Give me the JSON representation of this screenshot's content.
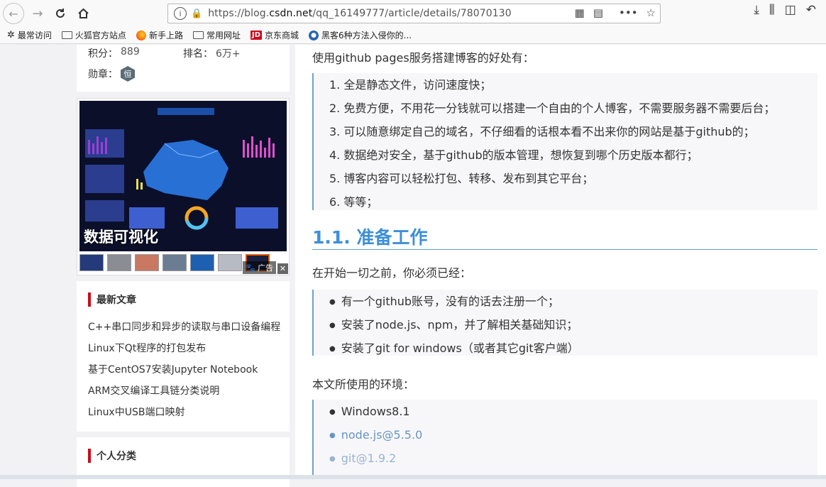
{
  "browser": {
    "url_prefix": "https://blog.",
    "url_domain": "csdn.net",
    "url_path": "/qq_16149777/article/details/78070130",
    "bookmarks": [
      {
        "label": "最常访问",
        "icon": "gear-icon"
      },
      {
        "label": "火狐官方站点",
        "icon": "folder-icon"
      },
      {
        "label": "新手上路",
        "icon": "firefox-icon"
      },
      {
        "label": "常用网址",
        "icon": "folder-icon"
      },
      {
        "label": "京东商城",
        "icon": "jd-icon",
        "icon_text": "JD"
      },
      {
        "label": "黑客6种方法入侵你的...",
        "icon": "globe-icon"
      }
    ]
  },
  "profile": {
    "score_label": "积分：",
    "score_value": "889",
    "rank_label": "排名：",
    "rank_value": "6万+",
    "medal_label": "勋章：",
    "medal_text": "恒"
  },
  "ad": {
    "caption": "数据可视化",
    "tag": "广告",
    "close": "✕"
  },
  "recent": {
    "title": "最新文章",
    "items": [
      "C++串口同步和异步的读取与串口设备编程",
      "Linux下Qt程序的打包发布",
      "基于CentOS7安装Jupyter Notebook",
      "ARM交叉编译工具链分类说明",
      "Linux中USB端口映射"
    ]
  },
  "category": {
    "title": "个人分类"
  },
  "article": {
    "intro": "使用github pages服务搭建博客的好处有：",
    "benefits": [
      "1. 全是静态文件，访问速度快；",
      "2. 免费方便，不用花一分钱就可以搭建一个自由的个人博客，不需要服务器不需要后台；",
      "3. 可以随意绑定自己的域名，不仔细看的话根本看不出来你的网站是基于github的；",
      "4. 数据绝对安全，基于github的版本管理，想恢复到哪个历史版本都行；",
      "5. 博客内容可以轻松打包、转移、发布到其它平台；",
      "6. 等等；"
    ],
    "heading": "1.1. 准备工作",
    "prereq_intro": "在开始一切之前，你必须已经：",
    "prereqs": [
      "有一个github账号，没有的话去注册一个；",
      "安装了node.js、npm，并了解相关基础知识；",
      "安装了git for windows（或者其它git客户端）"
    ],
    "env_intro": "本文所使用的环境：",
    "env": [
      "Windows8.1",
      "node.js@5.5.0",
      "git@1.9.2"
    ]
  }
}
